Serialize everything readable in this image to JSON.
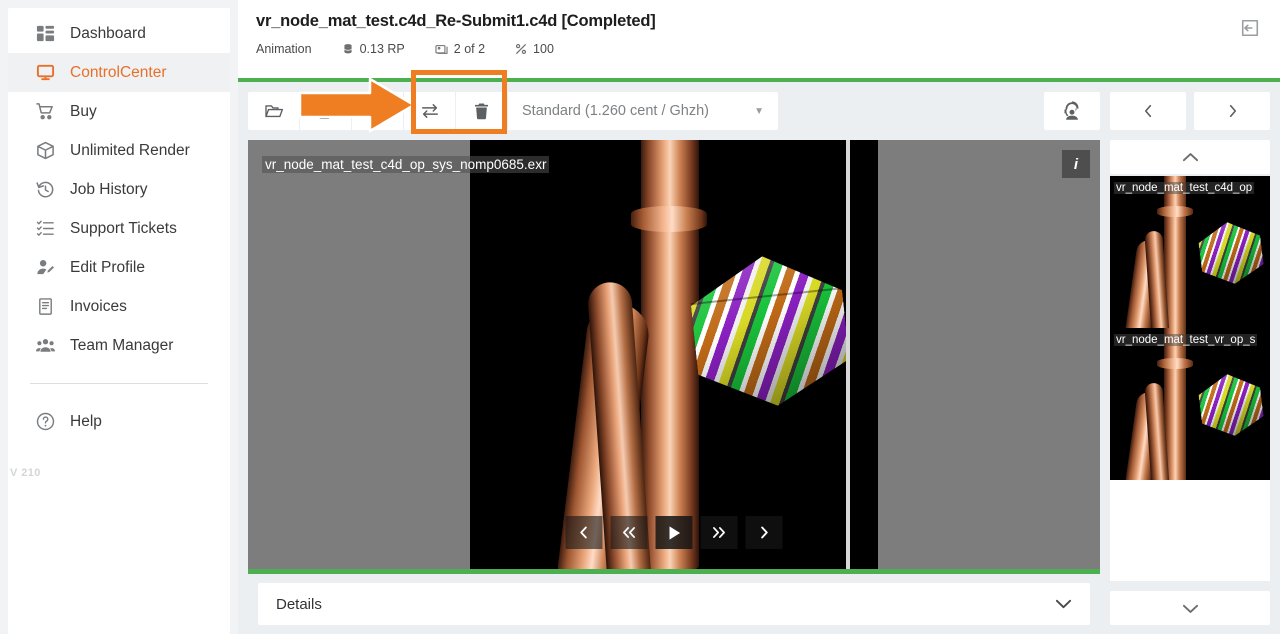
{
  "sidebar": {
    "items": [
      {
        "label": "Dashboard",
        "icon": "dashboard-icon",
        "active": false
      },
      {
        "label": "ControlCenter",
        "icon": "monitor-icon",
        "active": true
      },
      {
        "label": "Buy",
        "icon": "shopping-cart-icon",
        "active": false
      },
      {
        "label": "Unlimited Render",
        "icon": "box-icon",
        "active": false
      },
      {
        "label": "Job History",
        "icon": "history-clock-icon",
        "active": false
      },
      {
        "label": "Support Tickets",
        "icon": "checklist-icon",
        "active": false
      },
      {
        "label": "Edit Profile",
        "icon": "user-edit-icon",
        "active": false
      },
      {
        "label": "Invoices",
        "icon": "invoice-icon",
        "active": false
      },
      {
        "label": "Team Manager",
        "icon": "team-icon",
        "active": false
      }
    ],
    "help_label": "Help",
    "help_icon": "question-circle-icon",
    "version": "V 210",
    "active_color": "#e8702a"
  },
  "header": {
    "title": "vr_node_mat_test.c4d_Re-Submit1.c4d [Completed]",
    "meta": [
      {
        "label": "Animation",
        "icon": null
      },
      {
        "label": "0.13 RP",
        "icon": "coins-icon"
      },
      {
        "label": "2 of 2",
        "icon": "image-stack-icon"
      },
      {
        "label": "100",
        "icon": "percent-icon"
      }
    ],
    "collapse_icon": "collapse-panel-icon",
    "accent_color": "#4caf50"
  },
  "toolbar": {
    "buttons": [
      {
        "name": "open-folder-button",
        "icon": "folder-open-icon"
      },
      {
        "name": "duplicate-button",
        "icon": "copy-icon"
      },
      {
        "name": "restart-button",
        "icon": "refresh-icon"
      },
      {
        "name": "transfer-button",
        "icon": "swap-arrows-icon"
      },
      {
        "name": "delete-button",
        "icon": "trash-icon"
      }
    ],
    "dropdown_value": "Standard (1.260 cent / Ghzh)",
    "support_icon": "support-agent-icon",
    "prev_label": "‹",
    "next_label": "›"
  },
  "annotation": {
    "arrow_color": "#ef7d22",
    "highlight_color": "#ef7d22",
    "points_to": "restart-button"
  },
  "viewer": {
    "filename": "vr_node_mat_test_c4d_op_sys_nomp0685.exr",
    "info_label": "i",
    "letterbox_color": "#7d7d7d",
    "image_bg": "#000000",
    "playback": [
      {
        "name": "step-back-button",
        "glyph": "‹"
      },
      {
        "name": "rewind-button",
        "glyph": "«"
      },
      {
        "name": "play-button",
        "glyph": "▶"
      },
      {
        "name": "fast-forward-button",
        "glyph": "»"
      },
      {
        "name": "step-forward-button",
        "glyph": "›"
      }
    ]
  },
  "details": {
    "label": "Details",
    "chevron": "chevron-down-icon"
  },
  "thumbnails": {
    "scroll_up_icon": "chevron-up-icon",
    "scroll_down_icon": "chevron-down-icon",
    "items": [
      {
        "label": "vr_node_mat_test_c4d_op"
      },
      {
        "label": "vr_node_mat_test_vr_op_s"
      }
    ]
  }
}
